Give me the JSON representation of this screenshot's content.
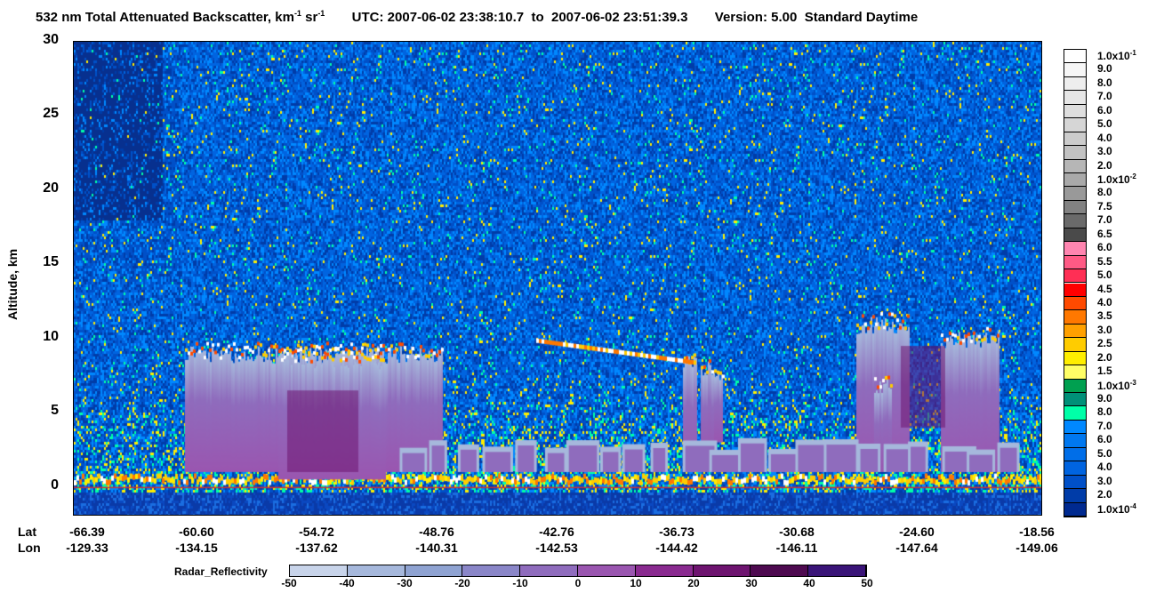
{
  "header": {
    "title_main": "532 nm Total Attenuated Backscatter, km",
    "title_unit_sup1": "-1",
    "title_sr": "sr",
    "title_unit_sup2": "-1",
    "utc_label": "UTC:",
    "utc_start": "2007-06-02 23:38:10.7",
    "to": "to",
    "utc_end": "2007-06-02 23:51:39.3",
    "version": "Version: 5.00",
    "mode": "Standard  Daytime"
  },
  "chart_data": {
    "type": "heatmap",
    "ylabel": "Altitude, km",
    "ylim": [
      -2,
      30
    ],
    "yticks": [
      "30",
      "25",
      "20",
      "15",
      "10",
      "5",
      "0"
    ],
    "x_row_labels": [
      "Lat",
      "Lon"
    ],
    "lat": [
      "-66.39",
      "-60.60",
      "-54.72",
      "-48.76",
      "-42.76",
      "-36.73",
      "-30.68",
      "-24.60",
      "-18.56"
    ],
    "lon": [
      "-129.33",
      "-134.15",
      "-137.62",
      "-140.31",
      "-142.53",
      "-144.42",
      "-146.11",
      "-147.64",
      "-149.06"
    ],
    "colorbar": {
      "labels": [
        "1.0x10",
        "9.0",
        "8.0",
        "7.0",
        "6.0",
        "5.0",
        "4.0",
        "3.0",
        "2.0",
        "1.0x10",
        "8.0",
        "7.5",
        "7.0",
        "6.5",
        "6.0",
        "5.5",
        "5.0",
        "4.5",
        "4.0",
        "3.5",
        "3.0",
        "2.5",
        "2.0",
        "1.5",
        "1.0x10",
        "9.0",
        "8.0",
        "7.0",
        "6.0",
        "5.0",
        "4.0",
        "3.0",
        "2.0",
        "1.0x10"
      ],
      "exponents": [
        "-1",
        "",
        "",
        "",
        "",
        "",
        "",
        "",
        "",
        "-2",
        "",
        "",
        "",
        "",
        "",
        "",
        "",
        "",
        "",
        "",
        "",
        "",
        "",
        "",
        "-3",
        "",
        "",
        "",
        "",
        "",
        "",
        "",
        "",
        "-4"
      ],
      "colors": [
        "#ffffff",
        "#f6f6f6",
        "#eeeeee",
        "#e6e6e6",
        "#dedede",
        "#d6d6d6",
        "#cccccc",
        "#c2c2c2",
        "#b6b6b6",
        "#a9a9a9",
        "#999999",
        "#828282",
        "#6a6a6a",
        "#4a4a4a",
        "#ff85b0",
        "#ff5a85",
        "#ff2f55",
        "#ff0000",
        "#ff4a00",
        "#ff7800",
        "#ffa000",
        "#ffcc00",
        "#ffee00",
        "#ffff66",
        "#00a050",
        "#009078",
        "#00ffa8",
        "#0088ff",
        "#0078f0",
        "#006ee8",
        "#0064e0",
        "#0050c8",
        "#003ca8",
        "#002a90"
      ]
    },
    "radar": {
      "title": "Radar_Reflectivity",
      "ticks": [
        "-50",
        "-40",
        "-30",
        "-20",
        "-10",
        "0",
        "10",
        "20",
        "30",
        "40",
        "50"
      ],
      "colors": [
        "#c8d4ea",
        "#a6b8dc",
        "#8fa3d2",
        "#8a86c8",
        "#8f6cbd",
        "#9a56b0",
        "#8a2a90",
        "#6e1470",
        "#4e0a50",
        "#3a1478"
      ]
    }
  }
}
